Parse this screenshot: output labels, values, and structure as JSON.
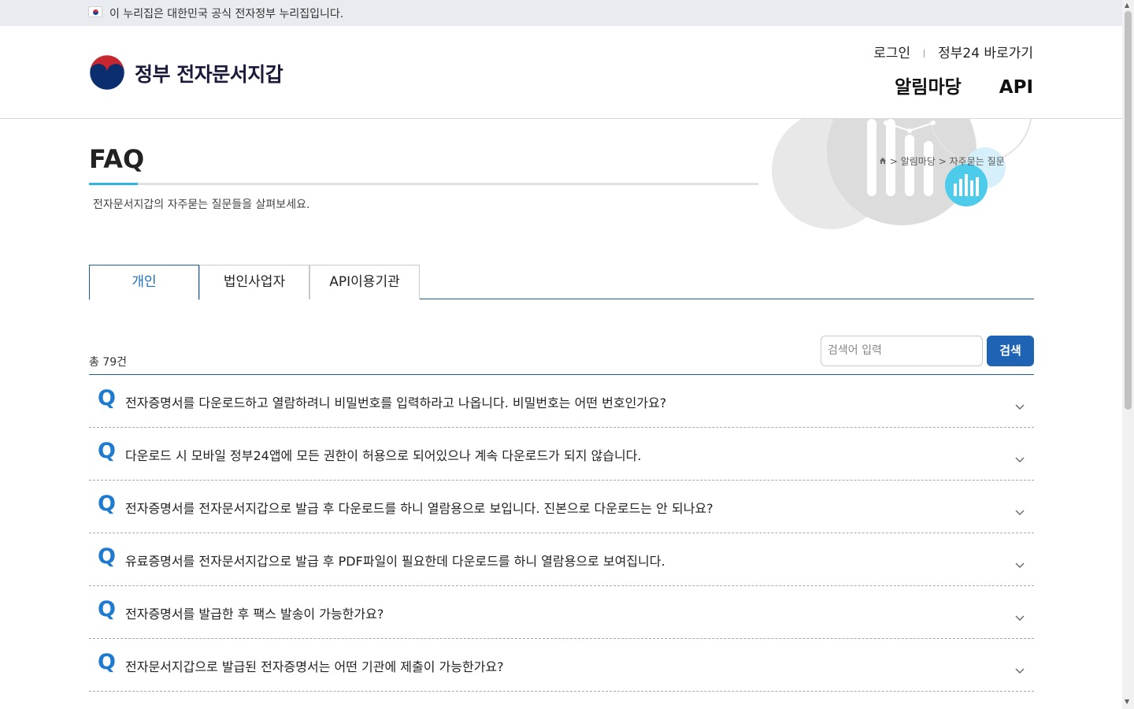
{
  "gov_banner": {
    "text": "이 누리집은 대한민국 공식 전자정부 누리집입니다."
  },
  "header": {
    "logo_text": "정부 전자문서지갑",
    "util": {
      "login": "로그인",
      "gov24": "정부24 바로가기"
    },
    "gnb": [
      "알림마당",
      "API"
    ]
  },
  "page": {
    "title": "FAQ",
    "description": "전자문서지갑의 자주묻는 질문들을 살펴보세요.",
    "breadcrumb": {
      "level1": "알림마당",
      "level2": "자주묻는 질문",
      "separator": ">"
    }
  },
  "tabs": [
    {
      "label": "개인",
      "active": true
    },
    {
      "label": "법인사업자",
      "active": false
    },
    {
      "label": "API이용기관",
      "active": false
    }
  ],
  "list_meta": {
    "total": "총 79건"
  },
  "search": {
    "placeholder": "검색어 입력",
    "button": "검색"
  },
  "faq": [
    {
      "q": "Q",
      "text": "전자증명서를 다운로드하고 열람하려니 비밀번호를 입력하라고 나옵니다. 비밀번호는 어떤 번호인가요?"
    },
    {
      "q": "Q",
      "text": "다운로드 시 모바일 정부24앱에 모든 권한이 허용으로 되어있으나 계속 다운로드가 되지 않습니다."
    },
    {
      "q": "Q",
      "text": "전자증명서를 전자문서지갑으로 발급 후 다운로드를 하니 열람용으로 보입니다. 진본으로 다운로드는 안 되나요?"
    },
    {
      "q": "Q",
      "text": "유료증명서를 전자문서지갑으로 발급 후 PDF파일이 필요한데 다운로드를 하니 열람용으로 보여집니다."
    },
    {
      "q": "Q",
      "text": "전자증명서를 발급한 후 팩스 발송이 가능한가요?"
    },
    {
      "q": "Q",
      "text": "전자문서지갑으로 발급된 전자증명서는 어떤 기관에 제출이 가능한가요?"
    }
  ],
  "colors": {
    "accent": "#1e63b4",
    "q_color": "#1e7bd0",
    "title_underline": "#34b4e3"
  },
  "icons": [
    "flag-icon",
    "emblem-icon",
    "home-icon",
    "chevron-down-icon",
    "chart-icon"
  ]
}
